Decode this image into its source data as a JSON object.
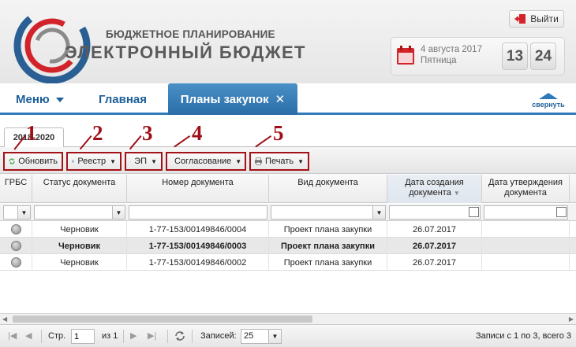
{
  "header": {
    "brand_line1": "БЮДЖЕТНОЕ ПЛАНИРОВАНИЕ",
    "brand_line2": "ЭЛЕКТРОННЫЙ БЮДЖЕТ",
    "logout_label": "Выйти",
    "date": "4 августа 2017",
    "weekday": "Пятница",
    "hours": "13",
    "minutes": "24",
    "colors": {
      "accent_red": "#d2232a",
      "logo_blue": "#2a6da8"
    }
  },
  "nav": {
    "menu_label": "Меню",
    "home_label": "Главная",
    "active_tab_label": "Планы закупок",
    "collapse_label": "свернуть"
  },
  "subtab": {
    "label": "2018-2020"
  },
  "toolbar": {
    "buttons": [
      {
        "label": "Обновить",
        "icon": "refresh-icon"
      },
      {
        "label": "Реестр",
        "icon": "registry-icon"
      },
      {
        "label": "ЭП",
        "icon": "signature-icon"
      },
      {
        "label": "Согласование",
        "icon": "approval-icon"
      },
      {
        "label": "Печать",
        "icon": "print-icon"
      }
    ],
    "callouts": [
      "1",
      "2",
      "3",
      "4",
      "5"
    ],
    "callout_color": "#9e1017"
  },
  "grid": {
    "columns": [
      "ГРБС",
      "Статус документа",
      "Номер документа",
      "Вид документа",
      "Дата создания документа",
      "Дата утверждения документа"
    ],
    "rows": [
      {
        "status": "Черновик",
        "number": "1-77-153/00149846/0004",
        "type": "Проект плана закупки",
        "created": "26.07.2017",
        "approved": ""
      },
      {
        "status": "Черновик",
        "number": "1-77-153/00149846/0003",
        "type": "Проект плана закупки",
        "created": "26.07.2017",
        "approved": ""
      },
      {
        "status": "Черновик",
        "number": "1-77-153/00149846/0002",
        "type": "Проект плана закупки",
        "created": "26.07.2017",
        "approved": ""
      }
    ]
  },
  "pager": {
    "page_label": "Стр.",
    "page_value": "1",
    "of_label": "из 1",
    "records_label": "Записей:",
    "records_value": "25",
    "summary": "Записи с 1 по 3, всего 3"
  }
}
